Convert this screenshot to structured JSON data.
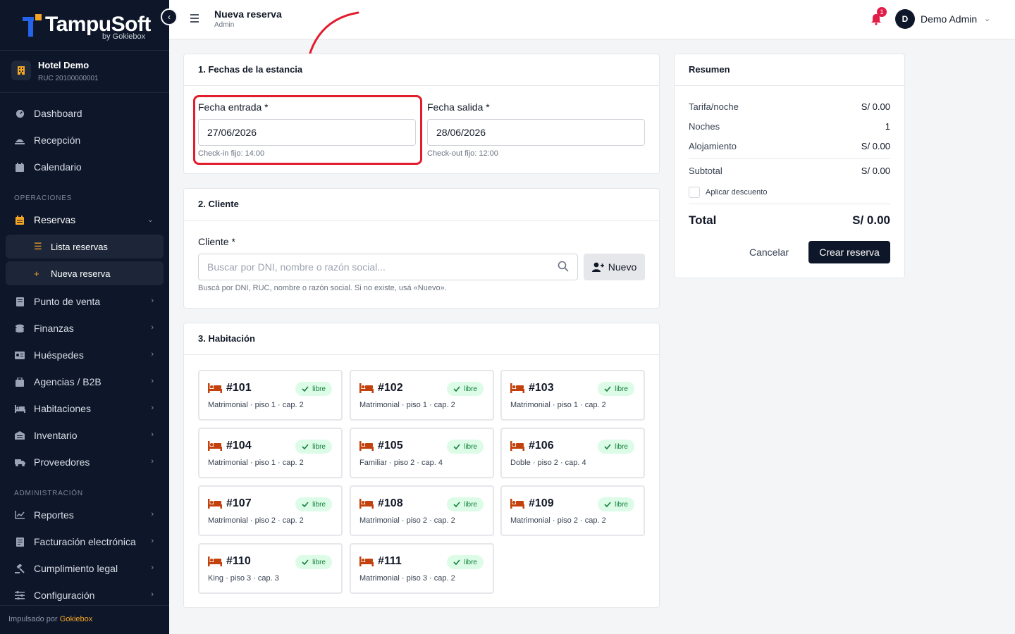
{
  "brand": {
    "name": "TampuSoft",
    "sub": "by Gokiebox"
  },
  "hotel": {
    "name": "Hotel Demo",
    "ruc": "RUC 20100000001"
  },
  "nav": {
    "dashboard": "Dashboard",
    "recepcion": "Recepción",
    "calendario": "Calendario",
    "section_operaciones": "OPERACIONES",
    "reservas": "Reservas",
    "lista_reservas": "Lista reservas",
    "nueva_reserva": "Nueva reserva",
    "punto_venta": "Punto de venta",
    "finanzas": "Finanzas",
    "huespedes": "Huéspedes",
    "agencias": "Agencias / B2B",
    "habitaciones": "Habitaciones",
    "inventario": "Inventario",
    "proveedores": "Proveedores",
    "section_administracion": "ADMINISTRACIÓN",
    "reportes": "Reportes",
    "facturacion": "Facturación electrónica",
    "cumplimiento": "Cumplimiento legal",
    "configuracion": "Configuración"
  },
  "footer": {
    "prefix": "Impulsado por",
    "brand": "Gokiebox"
  },
  "header": {
    "title": "Nueva reserva",
    "subtitle": "Admin",
    "notifications": "1",
    "avatar_initial": "D",
    "user_name": "Demo Admin"
  },
  "fechas": {
    "title": "1. Fechas de la estancia",
    "entrada_label": "Fecha entrada *",
    "entrada_value": "27/06/2026",
    "entrada_hint": "Check-in fijo: 14:00",
    "salida_label": "Fecha salida *",
    "salida_value": "28/06/2026",
    "salida_hint": "Check-out fijo: 12:00"
  },
  "cliente": {
    "title": "2. Cliente",
    "label": "Cliente *",
    "placeholder": "Buscar por DNI, nombre o razón social...",
    "nuevo": "Nuevo",
    "hint": "Buscá por DNI, RUC, nombre o razón social. Si no existe, usá «Nuevo»."
  },
  "habitacion": {
    "title": "3. Habitación",
    "status_label": "libre",
    "rooms": [
      {
        "num": "#101",
        "desc": "Matrimonial · piso 1 · cap. 2"
      },
      {
        "num": "#102",
        "desc": "Matrimonial · piso 1 · cap. 2"
      },
      {
        "num": "#103",
        "desc": "Matrimonial · piso 1 · cap. 2"
      },
      {
        "num": "#104",
        "desc": "Matrimonial · piso 1 · cap. 2"
      },
      {
        "num": "#105",
        "desc": "Familiar · piso 2 · cap. 4"
      },
      {
        "num": "#106",
        "desc": "Doble · piso 2 · cap. 4"
      },
      {
        "num": "#107",
        "desc": "Matrimonial · piso 2 · cap. 2"
      },
      {
        "num": "#108",
        "desc": "Matrimonial · piso 2 · cap. 2"
      },
      {
        "num": "#109",
        "desc": "Matrimonial · piso 2 · cap. 2"
      },
      {
        "num": "#110",
        "desc": "King · piso 3 · cap. 3"
      },
      {
        "num": "#111",
        "desc": "Matrimonial · piso 3 · cap. 2"
      }
    ]
  },
  "resumen": {
    "title": "Resumen",
    "tarifa_label": "Tarifa/noche",
    "tarifa_value": "S/ 0.00",
    "noches_label": "Noches",
    "noches_value": "1",
    "alojamiento_label": "Alojamiento",
    "alojamiento_value": "S/ 0.00",
    "subtotal_label": "Subtotal",
    "subtotal_value": "S/ 0.00",
    "descuento_label": "Aplicar descuento",
    "total_label": "Total",
    "total_value": "S/ 0.00",
    "cancel": "Cancelar",
    "create": "Crear reserva"
  },
  "colors": {
    "accent": "#f5a524",
    "sidebar_bg": "#0e1729",
    "highlight": "#e11d2e",
    "badge_bg": "#dcfce7"
  }
}
